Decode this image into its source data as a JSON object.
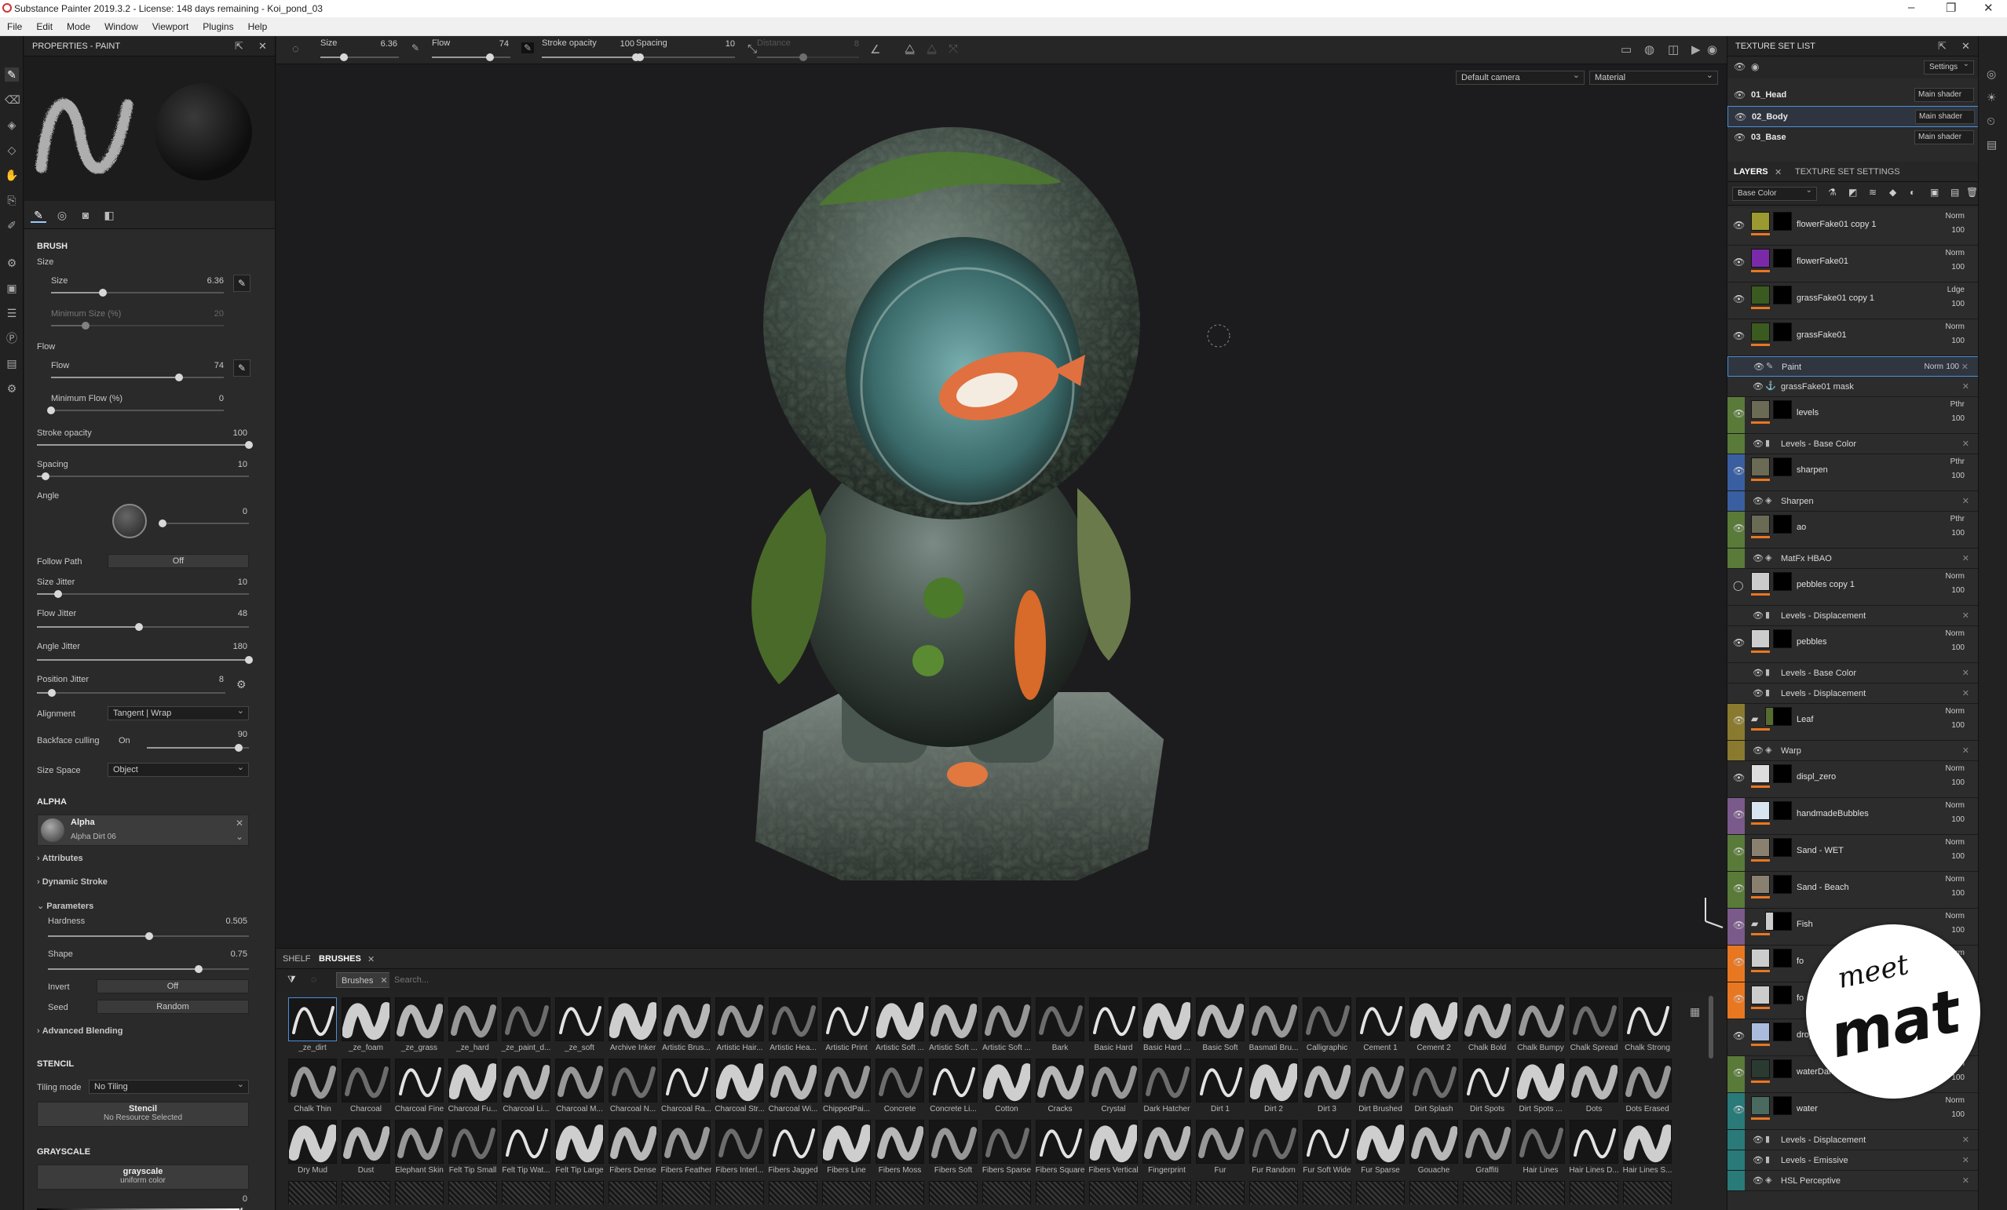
{
  "app": {
    "title": "Substance Painter 2019.3.2 - License: 148 days remaining - Koi_pond_03",
    "window_controls": [
      "–",
      "❐",
      "✕"
    ]
  },
  "menu": [
    "File",
    "Edit",
    "Mode",
    "Window",
    "Viewport",
    "Plugins",
    "Help"
  ],
  "properties": {
    "title": "PROPERTIES - PAINT",
    "brush_section": "BRUSH",
    "size_group": "Size",
    "size": {
      "label": "Size",
      "value": "6.36",
      "fraction": 0.3
    },
    "min_size": {
      "label": "Minimum Size (%)",
      "value": "20",
      "fraction": 0.2
    },
    "flow_group": "Flow",
    "flow": {
      "label": "Flow",
      "value": "74",
      "fraction": 0.74
    },
    "min_flow": {
      "label": "Minimum Flow (%)",
      "value": "0",
      "fraction": 0.0
    },
    "stroke_opacity": {
      "label": "Stroke opacity",
      "value": "100",
      "fraction": 1.0
    },
    "spacing": {
      "label": "Spacing",
      "value": "10",
      "fraction": 0.04
    },
    "angle": {
      "label": "Angle",
      "value": "0",
      "fraction": 0.0
    },
    "follow_path": {
      "label": "Follow Path",
      "value": "Off"
    },
    "size_jitter": {
      "label": "Size Jitter",
      "value": "10",
      "fraction": 0.1
    },
    "flow_jitter": {
      "label": "Flow Jitter",
      "value": "48",
      "fraction": 0.48
    },
    "angle_jitter": {
      "label": "Angle Jitter",
      "value": "180",
      "fraction": 1.0
    },
    "position_jitter": {
      "label": "Position Jitter",
      "value": "8",
      "fraction": 0.08
    },
    "alignment": {
      "label": "Alignment",
      "value": "Tangent | Wrap"
    },
    "backface": {
      "label": "Backface culling",
      "state": "On",
      "value": "90",
      "fraction": 0.9
    },
    "size_space": {
      "label": "Size Space",
      "value": "Object"
    },
    "alpha_section": "ALPHA",
    "alpha": {
      "name": "Alpha",
      "resource": "Alpha Dirt 06"
    },
    "attributes": "Attributes",
    "dynamic_stroke": "Dynamic Stroke",
    "parameters": "Parameters",
    "hardness": {
      "label": "Hardness",
      "value": "0.505",
      "fraction": 0.505
    },
    "shape": {
      "label": "Shape",
      "value": "0.75",
      "fraction": 0.75
    },
    "invert": {
      "label": "Invert",
      "value": "Off"
    },
    "seed": {
      "label": "Seed",
      "value": "Random"
    },
    "advanced_blending": "Advanced Blending",
    "stencil_section": "STENCIL",
    "tiling": {
      "label": "Tiling mode",
      "value": "No Tiling"
    },
    "stencil": {
      "name": "Stencil",
      "resource": "No Resource Selected"
    },
    "grayscale_section": "GRAYSCALE",
    "grayscale": {
      "name": "grayscale",
      "sub": "uniform color",
      "value": "0"
    }
  },
  "toolbar": {
    "size": {
      "label": "Size",
      "value": "6.36"
    },
    "flow": {
      "label": "Flow",
      "value": "74"
    },
    "stroke_opacity": {
      "label": "Stroke opacity",
      "value": "100"
    },
    "spacing": {
      "label": "Spacing",
      "value": "10"
    },
    "distance": {
      "label": "Distance",
      "value": "8"
    }
  },
  "viewport": {
    "camera": "Default camera",
    "mode": "Material"
  },
  "shelf": {
    "tabs": [
      "SHELF",
      "BRUSHES"
    ],
    "filter_chip": "Brushes",
    "search_placeholder": "Search...",
    "brushes_row1": [
      "_ze_dirt",
      "_ze_foam",
      "_ze_grass",
      "_ze_hard",
      "_ze_paint_d...",
      "_ze_soft",
      "Archive Inker",
      "Artistic Brus...",
      "Artistic Hair...",
      "Artistic Hea...",
      "Artistic Print",
      "Artistic Soft ...",
      "Artistic Soft ...",
      "Artistic Soft ...",
      "Bark",
      "Basic Hard",
      "Basic Hard ...",
      "Basic Soft",
      "Basmati Bru...",
      "Calligraphic",
      "Cement 1",
      "Cement 2",
      "Chalk Bold",
      "Chalk Bumpy",
      "Chalk Spread",
      "Chalk Strong"
    ],
    "brushes_row2": [
      "Chalk Thin",
      "Charcoal",
      "Charcoal Fine",
      "Charcoal Fu...",
      "Charcoal Li...",
      "Charcoal M...",
      "Charcoal N...",
      "Charcoal Ra...",
      "Charcoal Str...",
      "Charcoal Wi...",
      "ChippedPai...",
      "Concrete",
      "Concrete Li...",
      "Cotton",
      "Cracks",
      "Crystal",
      "Dark Hatcher",
      "Dirt 1",
      "Dirt 2",
      "Dirt 3",
      "Dirt Brushed",
      "Dirt Splash",
      "Dirt Spots",
      "Dirt Spots ...",
      "Dots",
      "Dots Erased"
    ],
    "brushes_row3": [
      "Dry Mud",
      "Dust",
      "Elephant Skin",
      "Felt Tip Small",
      "Felt Tip Wat...",
      "Felt Tip Large",
      "Fibers Dense",
      "Fibers Feather",
      "Fibers Interl...",
      "Fibers Jagged",
      "Fibers Line",
      "Fibers Moss",
      "Fibers Soft",
      "Fibers Sparse",
      "Fibers Square",
      "Fibers Vertical",
      "Fingerprint",
      "Fur",
      "Fur Random",
      "Fur Soft Wide",
      "Fur Sparse",
      "Gouache",
      "Graffiti",
      "Hair Lines",
      "Hair Lines D...",
      "Hair Lines S..."
    ]
  },
  "texture_sets": {
    "title": "TEXTURE SET LIST",
    "settings": "Settings",
    "items": [
      {
        "name": "01_Head",
        "shader": "Main shader"
      },
      {
        "name": "02_Body",
        "shader": "Main shader"
      },
      {
        "name": "03_Base",
        "shader": "Main shader"
      }
    ]
  },
  "layers_panel": {
    "tabs": [
      "LAYERS",
      "TEXTURE SET SETTINGS"
    ],
    "channel": "Base Color",
    "layers": [
      {
        "name": "flowerFake01 copy 1",
        "blend": "Norm",
        "opacity": "100",
        "color": "#9a9a30"
      },
      {
        "name": "flowerFake01",
        "blend": "Norm",
        "opacity": "100",
        "color": "#7a2aa8"
      },
      {
        "name": "grassFake01 copy 1",
        "blend": "Ldge",
        "opacity": "100",
        "color": "#3a5a20"
      },
      {
        "name": "grassFake01",
        "blend": "Norm",
        "opacity": "100",
        "color": "#3a5a20"
      },
      {
        "name": "levels",
        "blend": "Pthr",
        "opacity": "100",
        "color": "#6a6a55"
      },
      {
        "name": "sharpen",
        "blend": "Pthr",
        "opacity": "100",
        "color": "#6a6a55"
      },
      {
        "name": "ao",
        "blend": "Pthr",
        "opacity": "100",
        "color": "#6a6a55"
      },
      {
        "name": "pebbles copy 1",
        "blend": "Norm",
        "opacity": "100",
        "color": "#cccccc"
      },
      {
        "name": "pebbles",
        "blend": "Norm",
        "opacity": "100",
        "color": "#cccccc"
      },
      {
        "name": "Leaf",
        "blend": "Norm",
        "opacity": "100",
        "color": "#556b2f"
      },
      {
        "name": "displ_zero",
        "blend": "Norm",
        "opacity": "100",
        "color": "#dddddd"
      },
      {
        "name": "handmadeBubbles",
        "blend": "Norm",
        "opacity": "100",
        "color": "#d8e4f0"
      },
      {
        "name": "Sand - WET",
        "blend": "Norm",
        "opacity": "100",
        "color": "#8a8070"
      },
      {
        "name": "Sand - Beach",
        "blend": "Norm",
        "opacity": "100",
        "color": "#8a8070"
      },
      {
        "name": "Fish",
        "blend": "Norm",
        "opacity": "100",
        "color": "#cccccc"
      },
      {
        "name": "fo",
        "blend": "Norm",
        "opacity": "100",
        "color": "#cccccc"
      },
      {
        "name": "fo",
        "blend": "Norm",
        "opacity": "100",
        "color": "#cccccc"
      },
      {
        "name": "drop",
        "blend": "Norm",
        "opacity": "100",
        "color": "#aabbdd"
      },
      {
        "name": "waterDarken",
        "blend": "Norm",
        "opacity": "100",
        "color": "#2a3a30"
      },
      {
        "name": "water",
        "blend": "Norm",
        "opacity": "100",
        "color": "#4a6a60"
      }
    ],
    "sub_paint": {
      "name": "Paint",
      "blend": "Norm",
      "opacity": "100"
    },
    "sub_mask": "grassFake01 mask",
    "sub_levels_bc": "Levels - Base Color",
    "sub_sharpen": "Sharpen",
    "sub_hbao": "MatFx HBAO",
    "sub_levels_disp": "Levels - Displacement",
    "sub_warp": "Warp",
    "sub_emissive": "Levels - Emissive",
    "sub_hsl": "HSL Perceptive"
  },
  "watermark": {
    "line1": "meet",
    "line2": "mat"
  },
  "colors": {
    "accent": "#4a90d9",
    "orange": "#e87722",
    "bar_green": "#5a7a3a",
    "bar_blue": "#3a5fa0",
    "bar_yellow": "#8a7a30",
    "bar_purple": "#7a5a8a",
    "bar_teal": "#2a7a7a"
  }
}
